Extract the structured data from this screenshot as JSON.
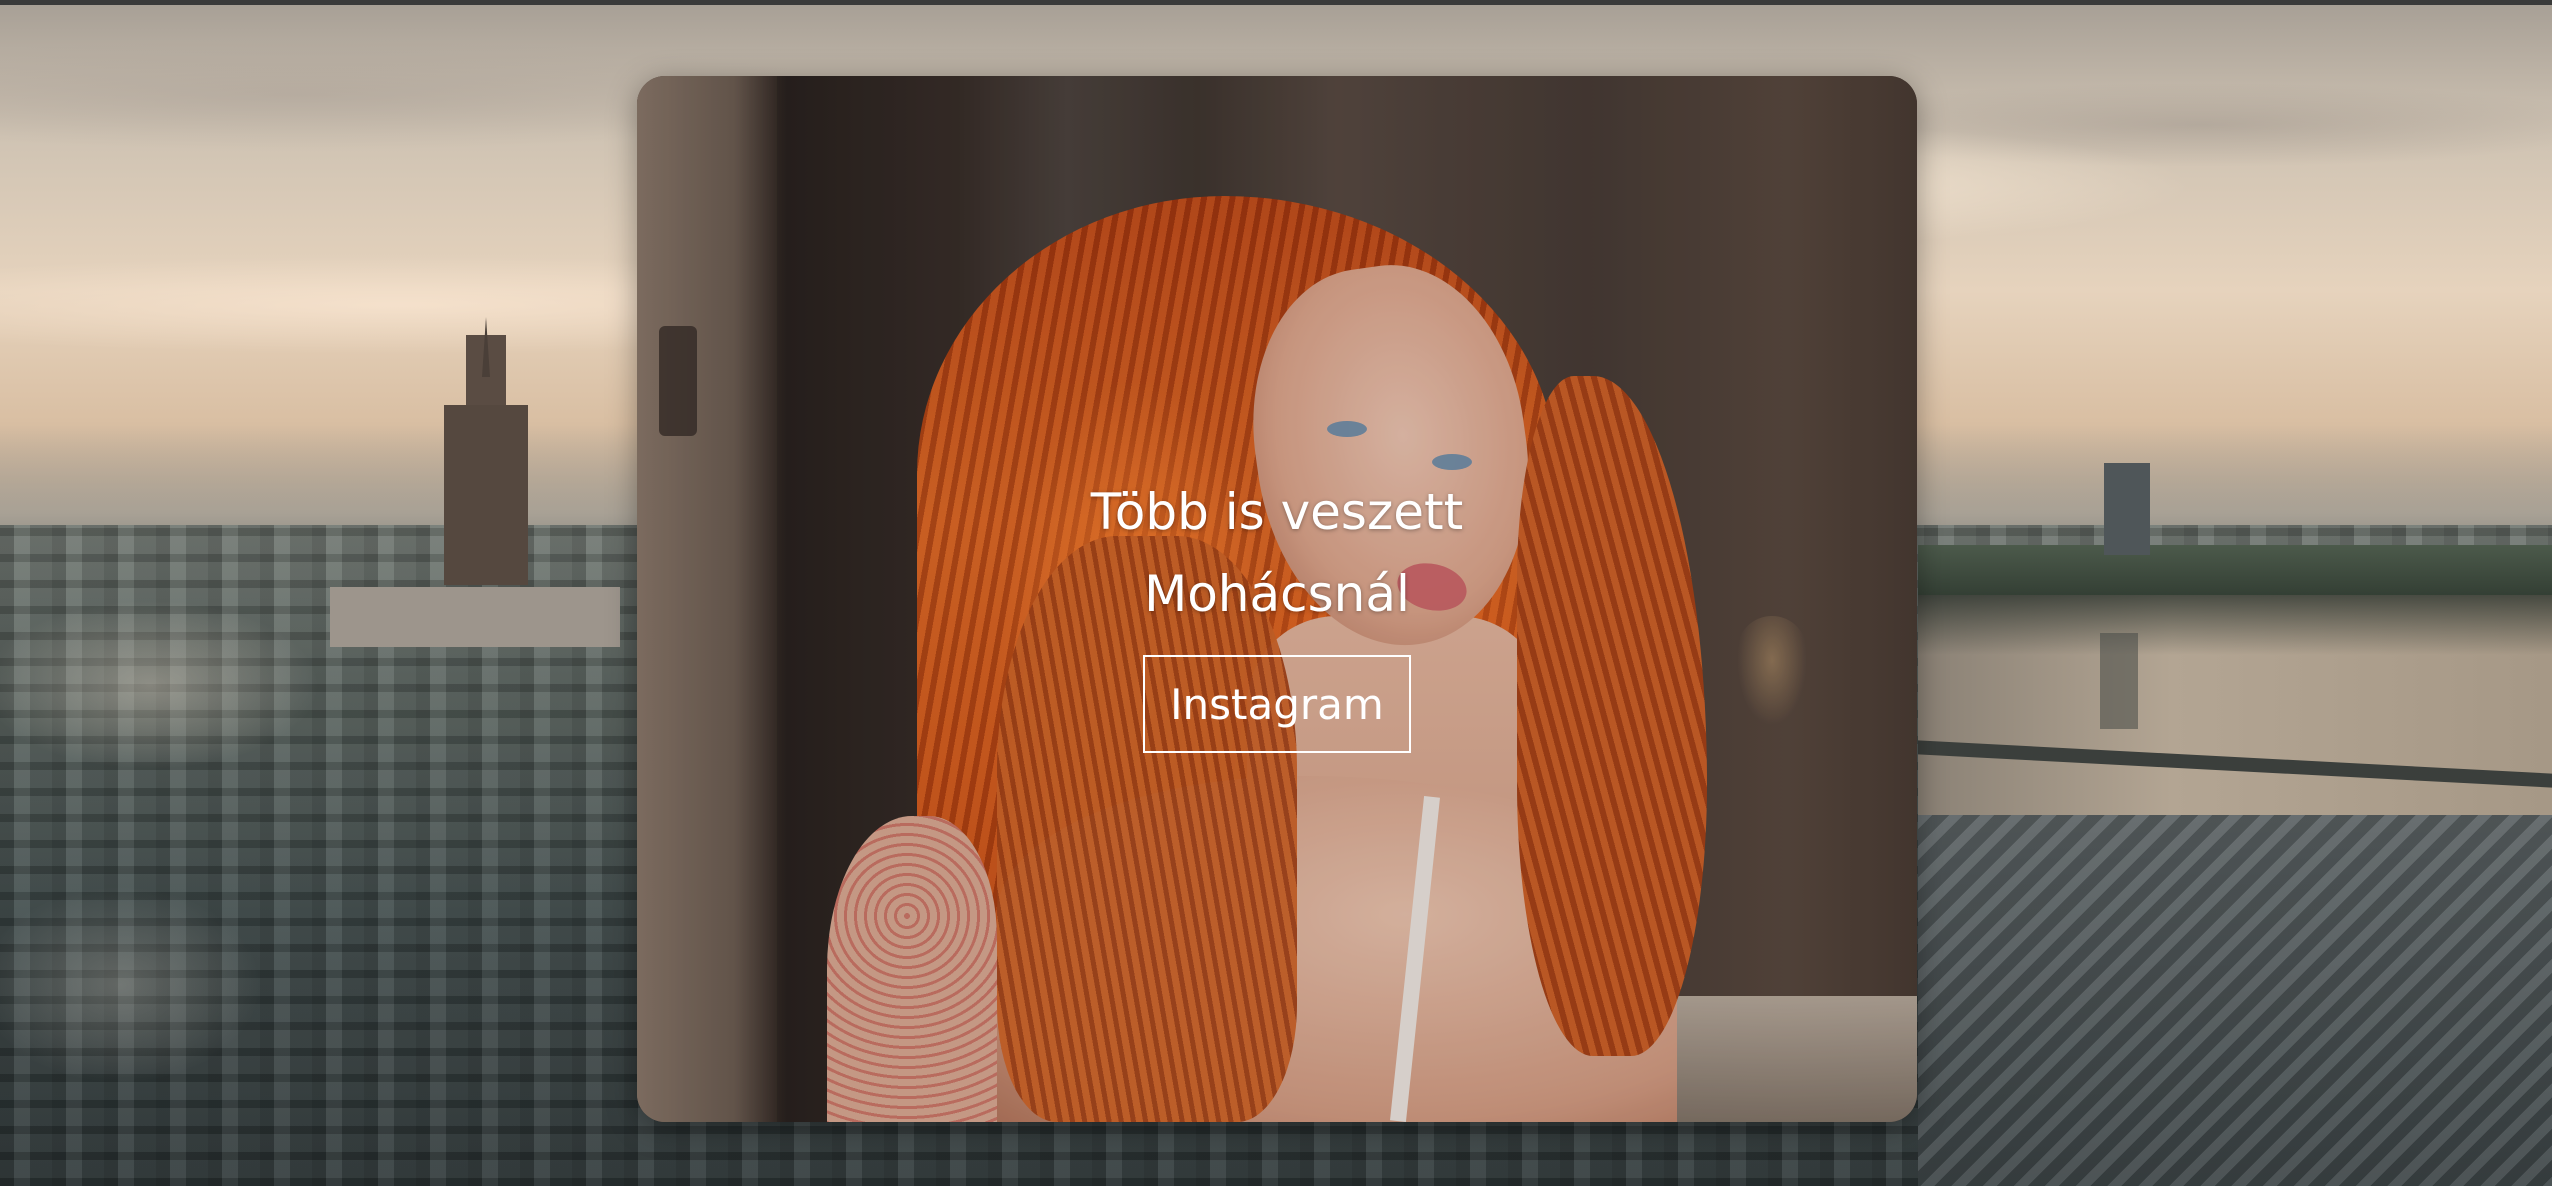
{
  "hero": {
    "headline": "Több is veszett Mohácsnál",
    "button_label": "Instagram"
  },
  "colors": {
    "text": "#ffffff",
    "button_border": "#ffffff",
    "hair_accent": "#c85a24"
  }
}
